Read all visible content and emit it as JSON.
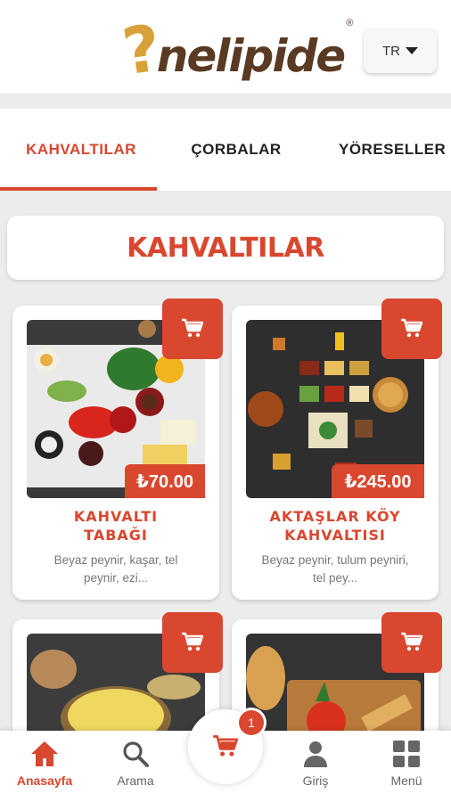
{
  "header": {
    "logo_q": "?",
    "logo_text": "nelipide",
    "logo_reg": "®",
    "language": "TR"
  },
  "tabs": [
    {
      "label": "KAHVALTILAR",
      "active": true
    },
    {
      "label": "ÇORBALAR",
      "active": false
    },
    {
      "label": "YÖRESELLER",
      "active": false
    }
  ],
  "section": {
    "title": "KAHVALTILAR"
  },
  "products": [
    {
      "name": "KAHVALTI TABAĞI",
      "price": "₺70.00",
      "description": "Beyaz peynir, kaşar, tel peynir, ezi..."
    },
    {
      "name": "AKTAŞLAR KÖY KAHVALTISI",
      "price": "₺245.00",
      "description": "Beyaz peynir, tulum peyniri, tel pey..."
    }
  ],
  "bottom_nav": {
    "home": "Anasayfa",
    "search": "Arama",
    "cart_count": "1",
    "login": "Giriş",
    "menu": "Menü"
  },
  "colors": {
    "accent": "#d9472e",
    "logo_brown": "#5a3a22",
    "logo_gold": "#d8a13a"
  }
}
